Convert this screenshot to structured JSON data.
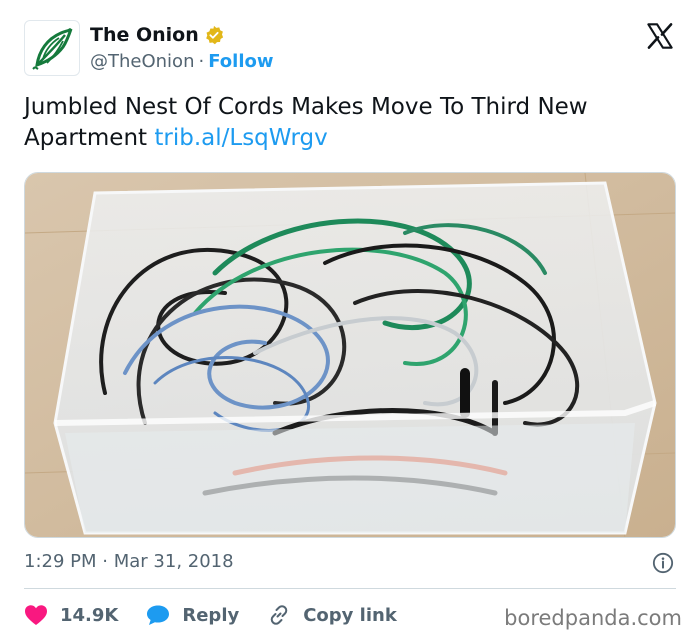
{
  "account": {
    "name": "The Onion",
    "handle": "@TheOnion",
    "separator": "·",
    "follow_label": "Follow"
  },
  "tweet": {
    "text": "Jumbled Nest Of Cords Makes Move To Third New Apartment ",
    "link": "trib.al/LsqWrgv"
  },
  "media": {
    "alt_icon": "photo-of-cords-in-plastic-bin"
  },
  "meta": {
    "time": "1:29 PM",
    "separator": "·",
    "date": "Mar 31, 2018"
  },
  "actions": {
    "likes": "14.9K",
    "reply_label": "Reply",
    "copy_label": "Copy link"
  },
  "watermark": "boredpanda.com",
  "colors": {
    "link": "#1d9bf0",
    "like": "#f91880",
    "text": "#0f1419",
    "muted": "#536471",
    "verified": "#e2b719",
    "onion_green": "#157a3c"
  }
}
